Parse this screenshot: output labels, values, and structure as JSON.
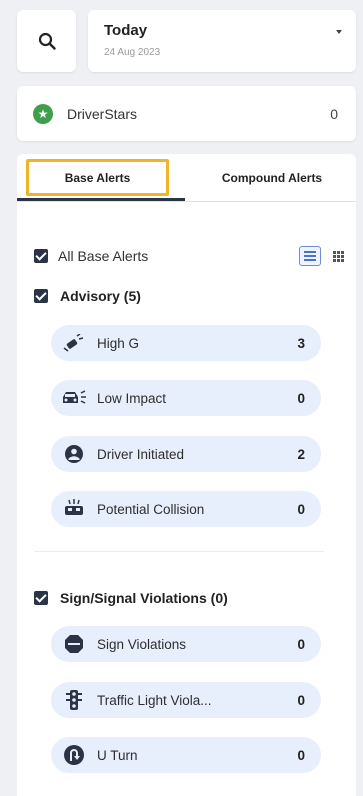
{
  "date": {
    "label": "Today",
    "sub": "24 Aug 2023"
  },
  "driverstars": {
    "label": "DriverStars",
    "count": "0"
  },
  "tabs": {
    "base": "Base Alerts",
    "compound": "Compound Alerts"
  },
  "all_base": {
    "label": "All Base Alerts"
  },
  "groups": [
    {
      "title": "Advisory (5)",
      "items": [
        {
          "label": "High G",
          "count": "3",
          "icon": "high-g-icon"
        },
        {
          "label": "Low Impact",
          "count": "0",
          "icon": "low-impact-icon"
        },
        {
          "label": "Driver Initiated",
          "count": "2",
          "icon": "driver-initiated-icon"
        },
        {
          "label": "Potential Collision",
          "count": "0",
          "icon": "potential-collision-icon"
        }
      ]
    },
    {
      "title": "Sign/Signal Violations (0)",
      "items": [
        {
          "label": "Sign Violations",
          "count": "0",
          "icon": "stop-sign-icon"
        },
        {
          "label": "Traffic Light Viola...",
          "count": "0",
          "icon": "traffic-light-icon"
        },
        {
          "label": "U Turn",
          "count": "0",
          "icon": "u-turn-icon"
        }
      ]
    }
  ],
  "colors": {
    "accent_tab_border": "#f0b429",
    "pill_bg": "#e7eefc",
    "checkbox": "#2b3447",
    "star_green": "#3f9e4c"
  }
}
